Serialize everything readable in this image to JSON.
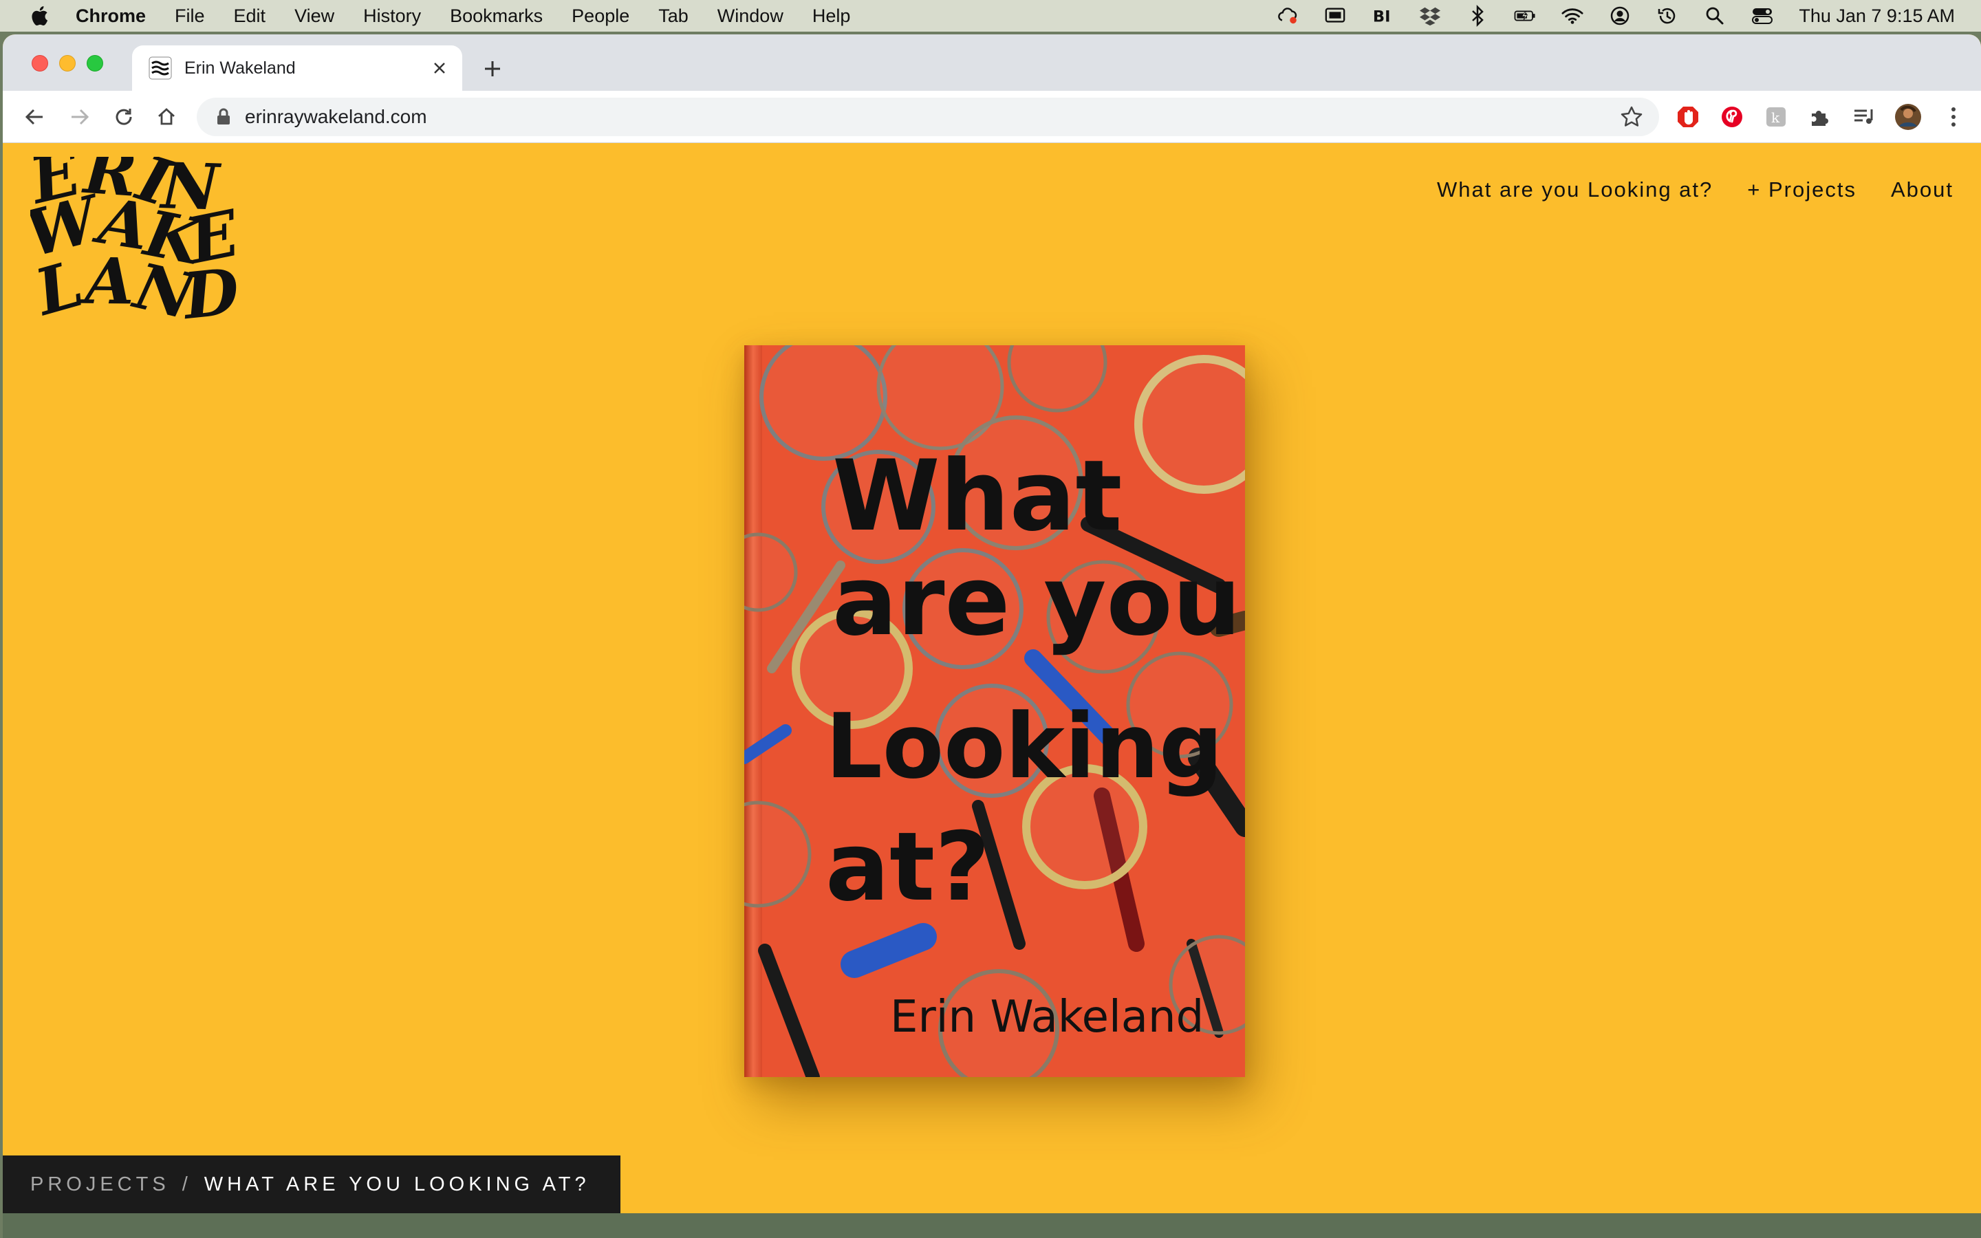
{
  "menubar": {
    "app_name": "Chrome",
    "items": [
      "File",
      "Edit",
      "View",
      "History",
      "Bookmarks",
      "People",
      "Tab",
      "Window",
      "Help"
    ],
    "clock": "Thu Jan 7  9:15 AM"
  },
  "browser": {
    "tab_title": "Erin Wakeland",
    "url": "erinraywakeland.com"
  },
  "site": {
    "logo_text": [
      "ERIN",
      "WAKE",
      "LAND"
    ],
    "nav": [
      "What are you Looking at?",
      "+ Projects",
      "About"
    ],
    "book_cover": {
      "title_lines": [
        "What",
        "are you",
        "Looking",
        "at?"
      ],
      "author": "Erin Wakeland"
    },
    "breadcrumb": {
      "parent": "PROJECTS",
      "separator": "/",
      "current": "WHAT ARE YOU LOOKING AT?"
    }
  },
  "colors": {
    "page_background": "#fcbd2c",
    "book_cover": "#e95331",
    "breadcrumb_background": "#1b1b1b"
  }
}
